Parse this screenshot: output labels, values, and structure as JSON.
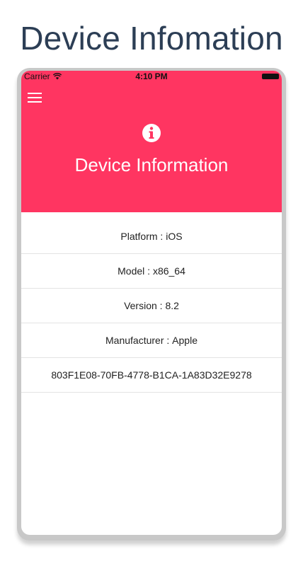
{
  "page": {
    "title": "Device Infomation"
  },
  "status_bar": {
    "carrier": "Carrier",
    "time": "4:10 PM",
    "wifi_icon": "wifi-icon",
    "battery_icon": "battery-icon"
  },
  "header": {
    "menu_icon": "hamburger-menu-icon",
    "info_icon": "info-icon",
    "title": "Device Information",
    "background_color": "#ff3561"
  },
  "info_rows": [
    {
      "label": "Platform",
      "value": "iOS"
    },
    {
      "label": "Model",
      "value": "x86_64"
    },
    {
      "label": "Version",
      "value": "8.2"
    },
    {
      "label": "Manufacturer",
      "value": "Apple"
    }
  ],
  "device_id": "803F1E08-70FB-4778-B1CA-1A83D32E9278",
  "colors": {
    "accent": "#ff3561",
    "title_text": "#2c3e55"
  }
}
